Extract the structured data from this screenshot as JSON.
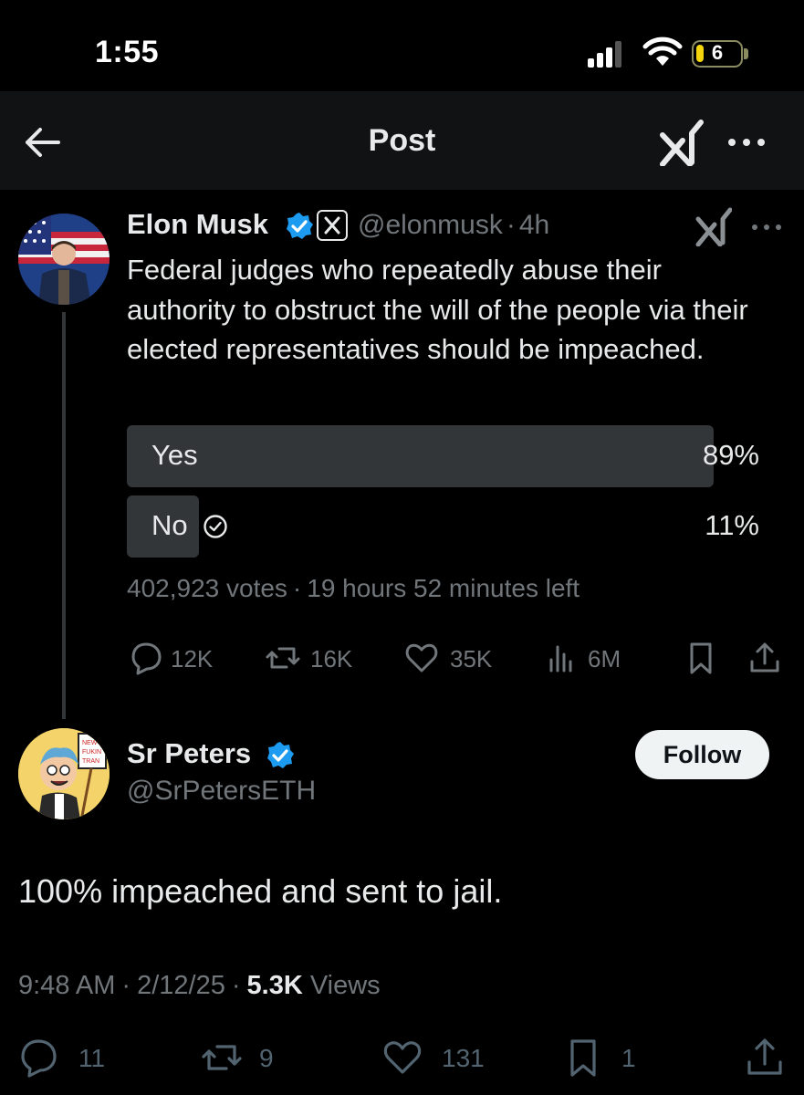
{
  "status_bar": {
    "time": "1:55",
    "battery_level": "6"
  },
  "header": {
    "title": "Post"
  },
  "quoted_post": {
    "author_name": "Elon Musk",
    "handle": "@elonmusk",
    "separator": "·",
    "time_ago": "4h",
    "text": "Federal judges who repeatedly abuse their authority to obstruct the will of the people via their elected representatives should be impeached.",
    "poll": {
      "options": [
        {
          "label": "Yes",
          "percent": "89%",
          "value": 89
        },
        {
          "label": "No",
          "percent": "11%",
          "value": 11,
          "voted": true
        }
      ],
      "votes": "402,923 votes",
      "time_left": "19 hours 52 minutes left"
    },
    "actions": {
      "replies": "12K",
      "reposts": "16K",
      "likes": "35K",
      "views": "6M"
    }
  },
  "reply": {
    "author_name": "Sr Peters",
    "handle": "@SrPetersETH",
    "follow_label": "Follow",
    "text": "100% impeached and sent to jail.",
    "time": "9:48 AM",
    "date": "2/12/25",
    "views_count": "5.3K",
    "views_label": "Views",
    "actions": {
      "replies": "11",
      "reposts": "9",
      "likes": "131",
      "bookmarks": "1"
    }
  },
  "colors": {
    "background": "#000000",
    "accent": "#1d9bf0",
    "muted": "#71767b",
    "poll_bar": "#333639"
  }
}
